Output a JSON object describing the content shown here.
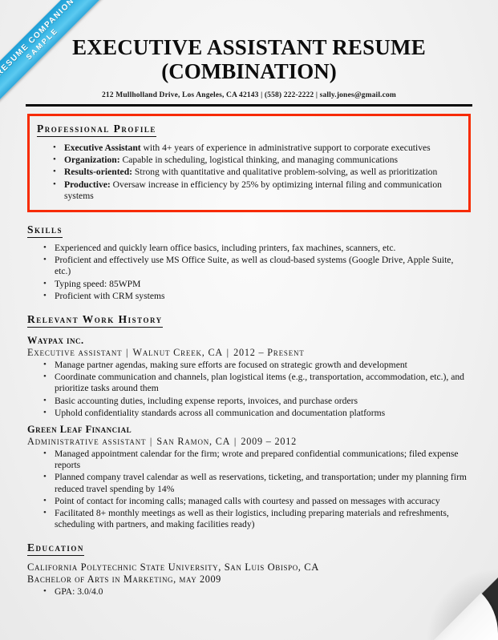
{
  "ribbon": {
    "line1": "RESUME COMPANION",
    "line2": "SAMPLE"
  },
  "header": {
    "title": "EXECUTIVE ASSISTANT RESUME",
    "subtitle": "(COMBINATION)",
    "contact": "212 Mullholland Drive, Los Angeles, CA 42143  |  (558) 222-2222 |  sally.jones@gmail.com"
  },
  "colors": {
    "highlight_box": "#f72b00",
    "ribbon": "#35b4e4",
    "rule": "#0a0a0a"
  },
  "sections": {
    "profile": {
      "title": "Professional Profile",
      "highlighted": true,
      "bullets": [
        {
          "lead": "Executive Assistant",
          "rest": " with 4+ years of experience in administrative support to corporate executives"
        },
        {
          "lead": "Organization:",
          "rest": " Capable in scheduling, logistical thinking, and managing communications"
        },
        {
          "lead": "Results-oriented:",
          "rest": " Strong with quantitative and qualitative problem-solving, as well as prioritization"
        },
        {
          "lead": "Productive:",
          "rest": " Oversaw increase in efficiency by 25% by optimizing internal filing and communication systems"
        }
      ]
    },
    "skills": {
      "title": "Skills",
      "bullets": [
        {
          "lead": "",
          "rest": "Experienced and quickly learn office basics, including printers, fax machines, scanners, etc."
        },
        {
          "lead": "",
          "rest": "Proficient and effectively use MS Office Suite, as well as cloud-based systems (Google Drive, Apple Suite, etc.)"
        },
        {
          "lead": "",
          "rest": "Typing speed: 85WPM"
        },
        {
          "lead": "",
          "rest": "Proficient with CRM systems"
        }
      ]
    },
    "work": {
      "title": "Relevant Work History",
      "jobs": [
        {
          "company": "Waypax inc.",
          "role": "Executive assistant",
          "location": "Walnut Creek, CA",
          "dates": "2012 – Present",
          "bullets": [
            "Manage partner agendas, making sure efforts are focused on strategic growth and development",
            "Coordinate communication and channels, plan logistical items (e.g., transportation, accommodation, etc.), and prioritize tasks around them",
            "Basic accounting duties, including expense reports, invoices, and purchase orders",
            "Uphold confidentiality standards across all communication and documentation platforms"
          ]
        },
        {
          "company": "Green Leaf Financial",
          "role": "Administrative assistant",
          "location": "San Ramon, CA",
          "dates": "2009 – 2012",
          "bullets": [
            "Managed appointment calendar for the firm; wrote and prepared confidential communications; filed expense reports",
            "Planned company travel calendar as well as reservations, ticketing, and transportation; under my planning firm reduced travel spending by 14%",
            "Point of contact for incoming calls; managed calls with courtesy and passed on messages with accuracy",
            "Facilitated 8+ monthly meetings as well as their logistics, including preparing materials and refreshments, scheduling with partners, and making facilities ready)"
          ]
        }
      ]
    },
    "education": {
      "title": "Education",
      "school": "California Polytechnic State University, San Luis Obispo, CA",
      "degree": "Bachelor of Arts in Marketing, may 2009",
      "bullets": [
        "GPA: 3.0/4.0"
      ]
    }
  }
}
